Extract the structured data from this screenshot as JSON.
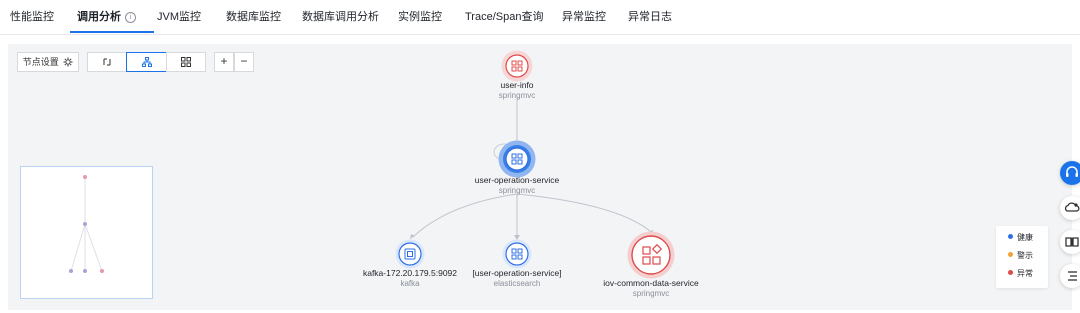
{
  "tabs": [
    {
      "label": "性能监控"
    },
    {
      "label": "调用分析",
      "active": true
    },
    {
      "label": "JVM监控"
    },
    {
      "label": "数据库监控"
    },
    {
      "label": "数据库调用分析"
    },
    {
      "label": "实例监控"
    },
    {
      "label": "Trace/Span查询"
    },
    {
      "label": "异常监控"
    },
    {
      "label": "异常日志"
    }
  ],
  "toolbar": {
    "node_settings_label": "节点设置",
    "zoom_in_label": "+",
    "zoom_out_label": "−"
  },
  "nodes": {
    "user_info": {
      "name": "user-info",
      "type": "springmvc",
      "status": "abnormal"
    },
    "user_operation": {
      "name": "user-operation-service",
      "type": "springmvc",
      "status": "healthy"
    },
    "kafka": {
      "name": "kafka-172.20.179.5:9092",
      "type": "kafka",
      "status": "healthy"
    },
    "es": {
      "name": "[user-operation-service]",
      "type": "elasticsearch",
      "status": "healthy"
    },
    "iov": {
      "name": "iov-common-data-service",
      "type": "springmvc",
      "status": "abnormal"
    }
  },
  "legend": {
    "healthy": {
      "label": "健康",
      "color": "#2f6fe4"
    },
    "warning": {
      "label": "警示",
      "color": "#f0a23a"
    },
    "abnormal": {
      "label": "异常",
      "color": "#e04a4a"
    }
  },
  "colors": {
    "accent": "#1a73e8"
  }
}
